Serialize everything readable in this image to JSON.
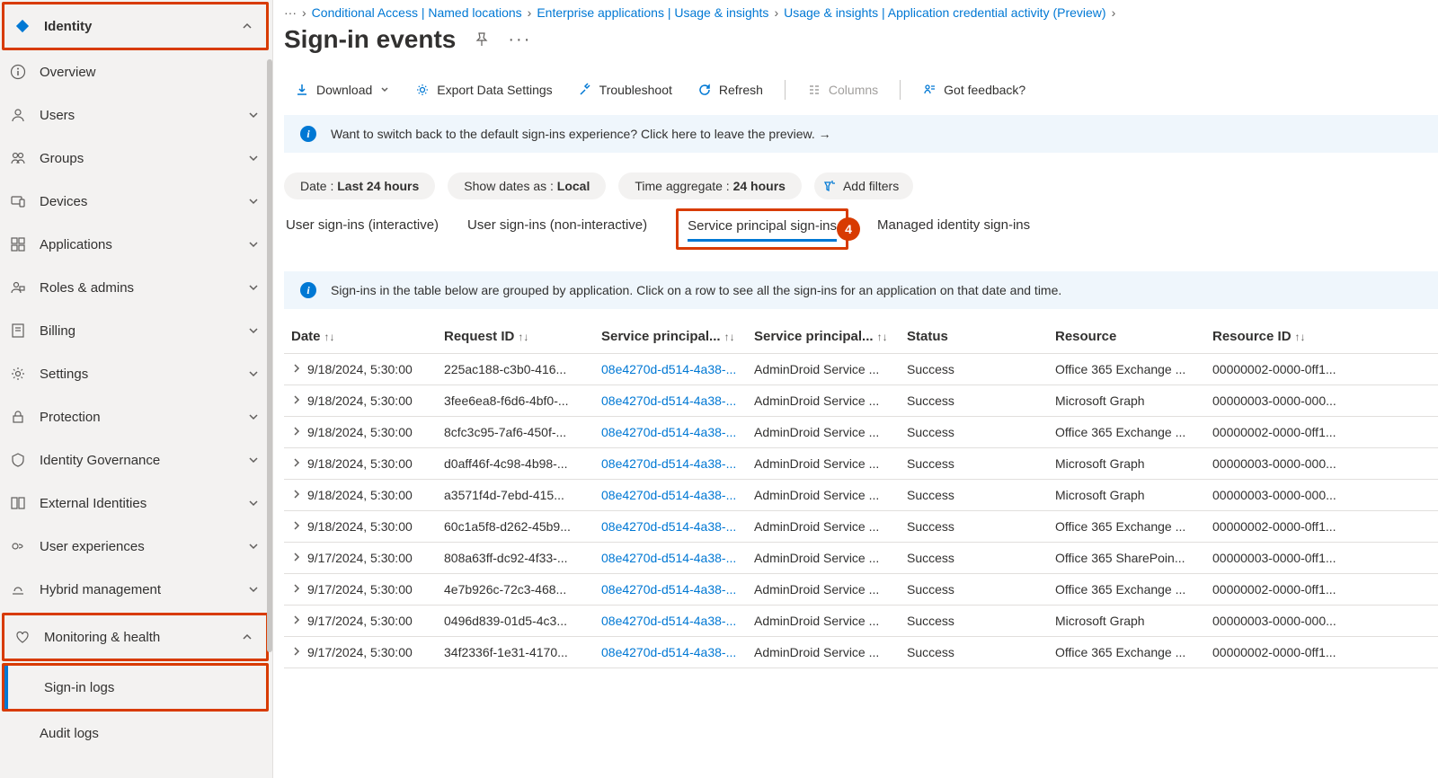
{
  "sidebar": {
    "identity": "Identity",
    "overview": "Overview",
    "users": "Users",
    "groups": "Groups",
    "devices": "Devices",
    "applications": "Applications",
    "roles": "Roles & admins",
    "billing": "Billing",
    "settings": "Settings",
    "protection": "Protection",
    "governance": "Identity Governance",
    "external": "External Identities",
    "userexp": "User experiences",
    "hybrid": "Hybrid management",
    "monitoring": "Monitoring & health",
    "signin": "Sign-in logs",
    "audit": "Audit logs"
  },
  "breadcrumb": {
    "b0": "···",
    "b1": "Conditional Access | Named locations",
    "b2": "Enterprise applications | Usage & insights",
    "b3": "Usage & insights | Application credential activity (Preview)"
  },
  "page": {
    "title": "Sign-in events"
  },
  "toolbar": {
    "download": "Download",
    "export": "Export Data Settings",
    "troubleshoot": "Troubleshoot",
    "refresh": "Refresh",
    "columns": "Columns",
    "feedback": "Got feedback?"
  },
  "banner1": "Want to switch back to the default sign-ins experience? Click here to leave the preview.  →",
  "filters": {
    "date_label": "Date : ",
    "date_val": "Last 24 hours",
    "showdates_label": "Show dates as : ",
    "showdates_val": "Local",
    "agg_label": "Time aggregate : ",
    "agg_val": "24 hours",
    "add": "Add filters"
  },
  "tabs": {
    "t1": "User sign-ins (interactive)",
    "t2": "User sign-ins (non-interactive)",
    "t3": "Service principal sign-ins",
    "t4": "Managed identity sign-ins"
  },
  "banner2": "Sign-ins in the table below are grouped by application. Click on a row to see all the sign-ins for an application on that date and time.",
  "columns": {
    "date": "Date",
    "reqid": "Request ID",
    "spid": "Service principal...",
    "spname": "Service principal...",
    "status": "Status",
    "resource": "Resource",
    "resid": "Resource ID"
  },
  "rows": [
    {
      "date": "9/18/2024, 5:30:00",
      "req": "225ac188-c3b0-416...",
      "spid": "08e4270d-d514-4a38-...",
      "spn": "AdminDroid Service ...",
      "status": "Success",
      "res": "Office 365 Exchange ...",
      "rid": "00000002-0000-0ff1..."
    },
    {
      "date": "9/18/2024, 5:30:00",
      "req": "3fee6ea8-f6d6-4bf0-...",
      "spid": "08e4270d-d514-4a38-...",
      "spn": "AdminDroid Service ...",
      "status": "Success",
      "res": "Microsoft Graph",
      "rid": "00000003-0000-000..."
    },
    {
      "date": "9/18/2024, 5:30:00",
      "req": "8cfc3c95-7af6-450f-...",
      "spid": "08e4270d-d514-4a38-...",
      "spn": "AdminDroid Service ...",
      "status": "Success",
      "res": "Office 365 Exchange ...",
      "rid": "00000002-0000-0ff1..."
    },
    {
      "date": "9/18/2024, 5:30:00",
      "req": "d0aff46f-4c98-4b98-...",
      "spid": "08e4270d-d514-4a38-...",
      "spn": "AdminDroid Service ...",
      "status": "Success",
      "res": "Microsoft Graph",
      "rid": "00000003-0000-000..."
    },
    {
      "date": "9/18/2024, 5:30:00",
      "req": "a3571f4d-7ebd-415...",
      "spid": "08e4270d-d514-4a38-...",
      "spn": "AdminDroid Service ...",
      "status": "Success",
      "res": "Microsoft Graph",
      "rid": "00000003-0000-000..."
    },
    {
      "date": "9/18/2024, 5:30:00",
      "req": "60c1a5f8-d262-45b9...",
      "spid": "08e4270d-d514-4a38-...",
      "spn": "AdminDroid Service ...",
      "status": "Success",
      "res": "Office 365 Exchange ...",
      "rid": "00000002-0000-0ff1..."
    },
    {
      "date": "9/17/2024, 5:30:00",
      "req": "808a63ff-dc92-4f33-...",
      "spid": "08e4270d-d514-4a38-...",
      "spn": "AdminDroid Service ...",
      "status": "Success",
      "res": "Office 365 SharePoin...",
      "rid": "00000003-0000-0ff1..."
    },
    {
      "date": "9/17/2024, 5:30:00",
      "req": "4e7b926c-72c3-468...",
      "spid": "08e4270d-d514-4a38-...",
      "spn": "AdminDroid Service ...",
      "status": "Success",
      "res": "Office 365 Exchange ...",
      "rid": "00000002-0000-0ff1..."
    },
    {
      "date": "9/17/2024, 5:30:00",
      "req": "0496d839-01d5-4c3...",
      "spid": "08e4270d-d514-4a38-...",
      "spn": "AdminDroid Service ...",
      "status": "Success",
      "res": "Microsoft Graph",
      "rid": "00000003-0000-000..."
    },
    {
      "date": "9/17/2024, 5:30:00",
      "req": "34f2336f-1e31-4170...",
      "spid": "08e4270d-d514-4a38-...",
      "spn": "AdminDroid Service ...",
      "status": "Success",
      "res": "Office 365 Exchange ...",
      "rid": "00000002-0000-0ff1..."
    }
  ]
}
